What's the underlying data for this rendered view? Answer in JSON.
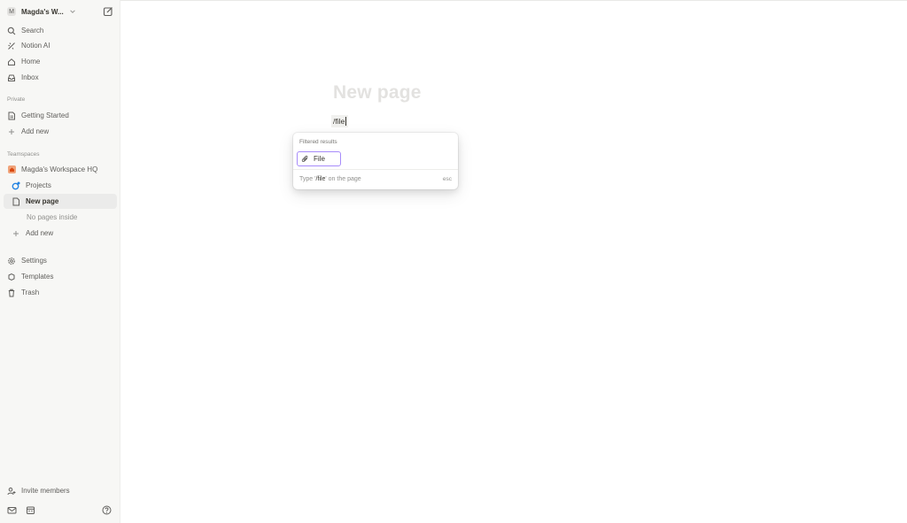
{
  "workspace": {
    "avatar_letter": "M",
    "name": "Magda's W..."
  },
  "nav": {
    "search": "Search",
    "notion_ai": "Notion AI",
    "home": "Home",
    "inbox": "Inbox"
  },
  "private": {
    "label": "Private",
    "getting_started": "Getting Started",
    "add_new": "Add new"
  },
  "teamspaces": {
    "label": "Teamspaces",
    "hq": "Magda's Workspace HQ",
    "projects": "Projects",
    "new_page": "New page",
    "no_pages": "No pages inside",
    "add_new": "Add new"
  },
  "settings_nav": {
    "settings": "Settings",
    "templates": "Templates",
    "trash": "Trash"
  },
  "invite": "Invite members",
  "main": {
    "title": "New page",
    "typed": "/file"
  },
  "popup": {
    "label": "Filtered results",
    "item": "File",
    "footer_prefix": "Type '",
    "footer_cmd": "/file",
    "footer_suffix": "' on the page",
    "esc": "esc"
  },
  "colors": {
    "accent": "#a78bfa",
    "sidebar_bg": "#f7f7f5",
    "title_placeholder": "#e3e2e0",
    "projects_icon": "#2383e2"
  }
}
